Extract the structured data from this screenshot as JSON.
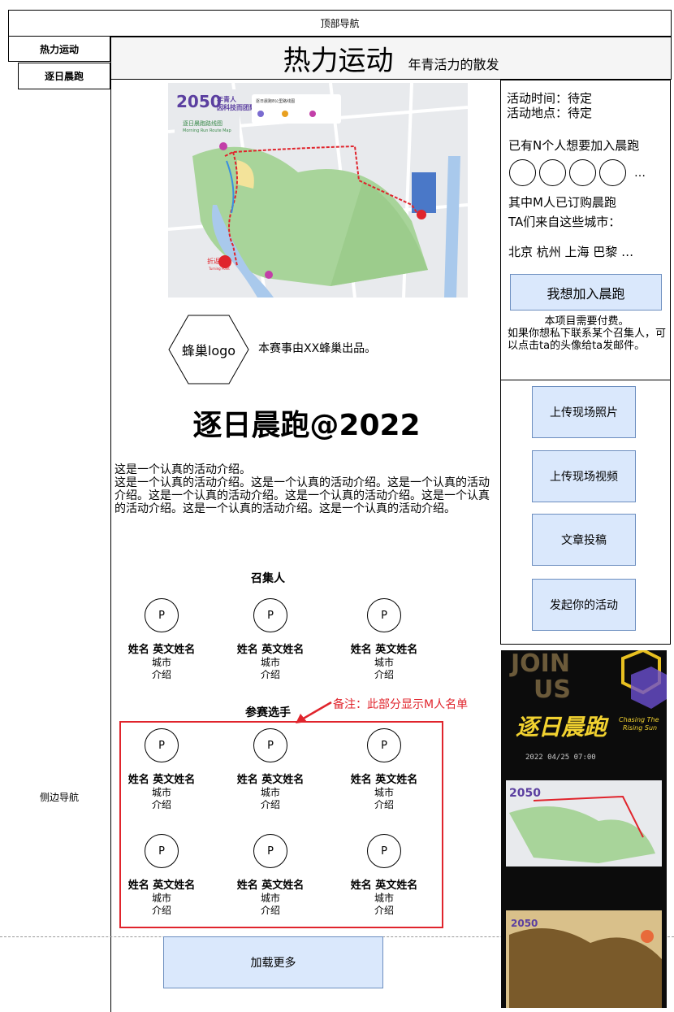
{
  "top_nav": {
    "label": "顶部导航"
  },
  "side_nav": {
    "hot_label": "热力运动",
    "sub_label": "逐日晨跑",
    "label": "侧边导航"
  },
  "header": {
    "title": "热力运动",
    "subtitle": "年青活力的散发"
  },
  "map_image": {
    "brand_number": "2050",
    "brand_line1": "年青人",
    "brand_line2": "因科技而团聚",
    "subtitle": "逐日晨跑路线图",
    "english": "Morning Run Route Map",
    "turn_label": "折返点",
    "turn_english": "Turning Point",
    "legend_title": "逐日晨跑8公里路线图"
  },
  "sponsor": {
    "logo_label": "蜂巢logo",
    "text": "本赛事由XX蜂巢出品。"
  },
  "event": {
    "title": "逐日晨跑@2022",
    "intro": "这是一个认真的活动介绍。\n这是一个认真的活动介绍。这是一个认真的活动介绍。这是一个认真的活动介绍。这是一个认真的活动介绍。这是一个认真的活动介绍。这是一个认真的活动介绍。这是一个认真的活动介绍。这是一个认真的活动介绍。"
  },
  "organizers": {
    "title": "召集人",
    "people": [
      {
        "avatar": "P",
        "name": "姓名 英文姓名",
        "city": "城市",
        "bio": "介绍"
      },
      {
        "avatar": "P",
        "name": "姓名 英文姓名",
        "city": "城市",
        "bio": "介绍"
      },
      {
        "avatar": "P",
        "name": "姓名 英文姓名",
        "city": "城市",
        "bio": "介绍"
      }
    ]
  },
  "participants": {
    "title": "参赛选手",
    "note": "备注：此部分显示M人名单",
    "people": [
      {
        "avatar": "P",
        "name": "姓名 英文姓名",
        "city": "城市",
        "bio": "介绍"
      },
      {
        "avatar": "P",
        "name": "姓名 英文姓名",
        "city": "城市",
        "bio": "介绍"
      },
      {
        "avatar": "P",
        "name": "姓名 英文姓名",
        "city": "城市",
        "bio": "介绍"
      },
      {
        "avatar": "P",
        "name": "姓名 英文姓名",
        "city": "城市",
        "bio": "介绍"
      },
      {
        "avatar": "P",
        "name": "姓名 英文姓名",
        "city": "城市",
        "bio": "介绍"
      },
      {
        "avatar": "P",
        "name": "姓名 英文姓名",
        "city": "城市",
        "bio": "介绍"
      }
    ]
  },
  "load_more": {
    "label": "加载更多"
  },
  "info_panel": {
    "time": "活动时间：待定",
    "place": "活动地点：待定",
    "wanting": "已有N个人想要加入晨跑",
    "more": "…",
    "ordered": "其中M人已订购晨跑",
    "from": "TA们来自这些城市：",
    "cities": "北京 杭州 上海 巴黎 …",
    "join_button": "我想加入晨跑",
    "fee_line1": "本项目需要付费。",
    "fee_line2": "如果你想私下联系某个召集人，可以点击ta的头像给ta发邮件。"
  },
  "actions": {
    "upload_photo": "上传现场照片",
    "upload_video": "上传现场视频",
    "submit_article": "文章投稿",
    "start_event": "发起你的活动"
  },
  "poster": {
    "join": "JOIN",
    "us": "US",
    "logo": "逐日晨跑",
    "en_line1": "Chasing The",
    "en_line2": "Rising Sun",
    "date": "2022 04/25 07:00"
  },
  "colors": {
    "button_fill": "#dae8fc",
    "button_border": "#6c8ebf",
    "note_red": "#e0242c",
    "brand_purple": "#5b3fa0"
  }
}
